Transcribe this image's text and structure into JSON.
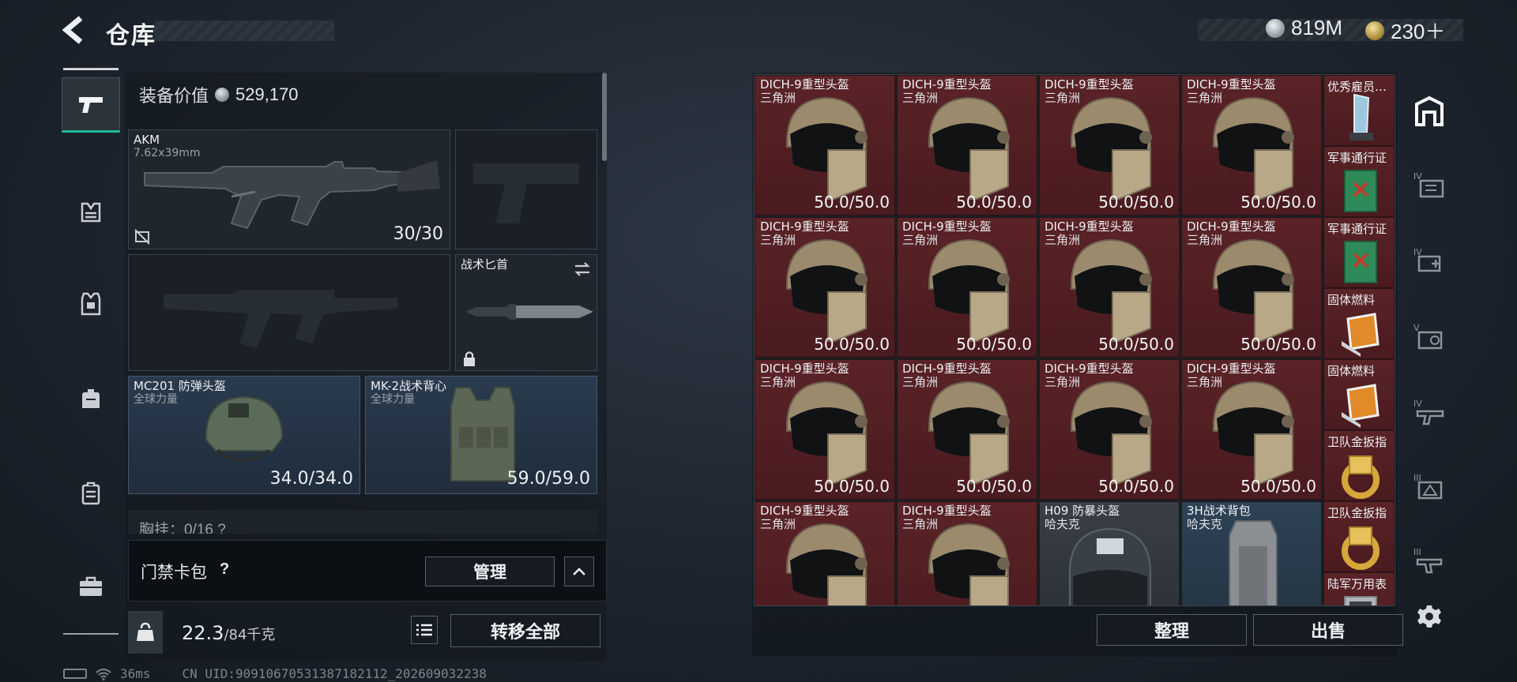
{
  "header": {
    "title": "仓库",
    "silver_amount": "819M",
    "gold_amount": "230＋"
  },
  "left_nav": {
    "items": [
      {
        "icon": "pistol-icon",
        "active": true
      },
      {
        "icon": "tactical-rig-icon"
      },
      {
        "icon": "armor-vest-icon"
      },
      {
        "icon": "backpack-icon"
      },
      {
        "icon": "case-icon"
      },
      {
        "icon": "briefcase-icon"
      }
    ]
  },
  "equipment": {
    "value_label": "装备价值",
    "value": "529,170",
    "primary": {
      "name": "AKM",
      "caliber": "7.62x39mm",
      "ammo": "30/30"
    },
    "knife": {
      "name": "战术匕首"
    },
    "helmet": {
      "name": "MC201 防弹头盔",
      "faction": "全球力量",
      "durability": "34.0/34.0"
    },
    "vest": {
      "name": "MK-2战术背心",
      "faction": "全球力量",
      "durability": "59.0/59.0"
    },
    "chest_rig": {
      "label": "胸挂：0/16  ?"
    }
  },
  "keycard": {
    "label": "门禁卡包",
    "help": "?",
    "manage_label": "管理"
  },
  "weight": {
    "current": "22.3",
    "max": "/84千克",
    "kg_label": "KG",
    "transfer_all_label": "转移全部"
  },
  "footer": {
    "ping": "36ms",
    "uid": "CN UID:9091067053138718211​2_202609032238"
  },
  "grid": {
    "items": [
      {
        "name": "DICH-9重型头盔",
        "map": "三角洲",
        "durability": "50.0/50.0",
        "kind": "helmet"
      },
      {
        "name": "DICH-9重型头盔",
        "map": "三角洲",
        "durability": "50.0/50.0",
        "kind": "helmet"
      },
      {
        "name": "DICH-9重型头盔",
        "map": "三角洲",
        "durability": "50.0/50.0",
        "kind": "helmet"
      },
      {
        "name": "DICH-9重型头盔",
        "map": "三角洲",
        "durability": "50.0/50.0",
        "kind": "helmet"
      },
      {
        "name": "DICH-9重型头盔",
        "map": "三角洲",
        "durability": "50.0/50.0",
        "kind": "helmet"
      },
      {
        "name": "DICH-9重型头盔",
        "map": "三角洲",
        "durability": "50.0/50.0",
        "kind": "helmet"
      },
      {
        "name": "DICH-9重型头盔",
        "map": "三角洲",
        "durability": "50.0/50.0",
        "kind": "helmet"
      },
      {
        "name": "DICH-9重型头盔",
        "map": "三角洲",
        "durability": "50.0/50.0",
        "kind": "helmet"
      },
      {
        "name": "DICH-9重型头盔",
        "map": "三角洲",
        "durability": "50.0/50.0",
        "kind": "helmet"
      },
      {
        "name": "DICH-9重型头盔",
        "map": "三角洲",
        "durability": "50.0/50.0",
        "kind": "helmet"
      },
      {
        "name": "DICH-9重型头盔",
        "map": "三角洲",
        "durability": "50.0/50.0",
        "kind": "helmet"
      },
      {
        "name": "DICH-9重型头盔",
        "map": "三角洲",
        "durability": "50.0/50.0",
        "kind": "helmet"
      },
      {
        "name": "DICH-9重型头盔",
        "map": "三角洲",
        "durability": "",
        "kind": "helmet"
      },
      {
        "name": "DICH-9重型头盔",
        "map": "三角洲",
        "durability": "",
        "kind": "helmet"
      },
      {
        "name": "H09 防暴头盔",
        "map": "哈夫克",
        "durability": "",
        "kind": "riot"
      },
      {
        "name": "3H战术背包",
        "map": "哈夫克",
        "durability": "",
        "kind": "bag"
      }
    ],
    "side_items": [
      {
        "name": "优秀雇员…",
        "kind": "trophy"
      },
      {
        "name": "军事通行证",
        "kind": "book"
      },
      {
        "name": "军事通行证",
        "kind": "book"
      },
      {
        "name": "固体燃料",
        "kind": "fuel"
      },
      {
        "name": "固体燃料",
        "kind": "fuel"
      },
      {
        "name": "卫队金扳指",
        "kind": "ring"
      },
      {
        "name": "卫队金扳指",
        "kind": "ring"
      },
      {
        "name": "陆军万用表",
        "kind": "meter"
      }
    ],
    "sort_label": "整理",
    "sell_label": "出售"
  },
  "right_nav": {
    "items": [
      "stash-icon",
      "container-iv-icon",
      "container-iv-plus-icon",
      "container-v-icon",
      "container-iv-gun-icon",
      "container-iii-icon",
      "container-iii-gun-icon",
      "settings-icon"
    ]
  }
}
